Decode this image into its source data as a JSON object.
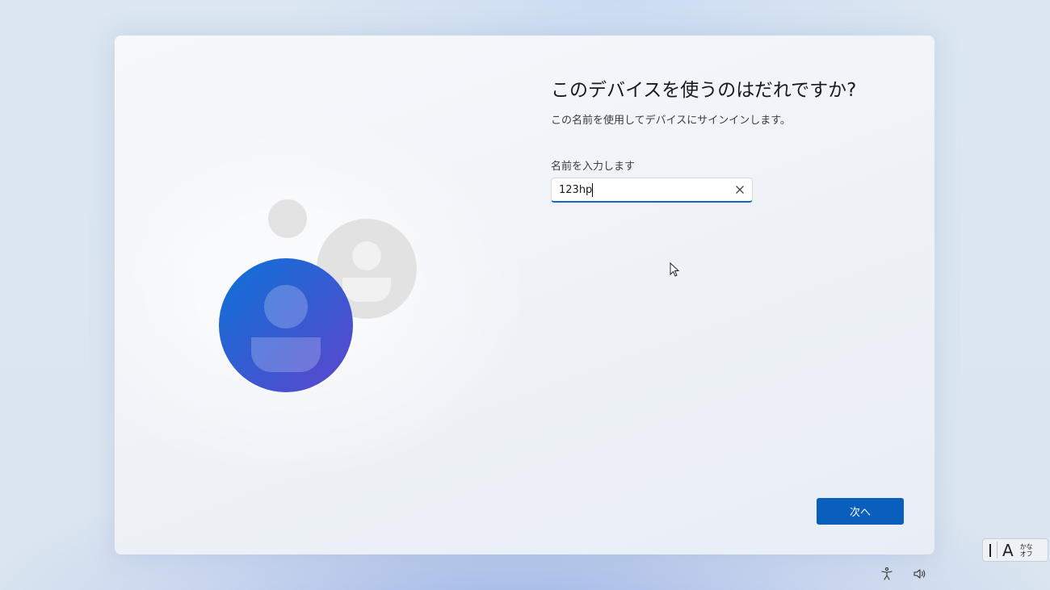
{
  "setup": {
    "title": "このデバイスを使うのはだれですか?",
    "subtitle": "この名前を使用してデバイスにサインインします。",
    "name_field": {
      "label": "名前を入力します",
      "value": "123hp"
    },
    "next_button_label": "次へ"
  },
  "ime_indicator": {
    "mode_letter": "A",
    "kana_line1": "かな",
    "kana_line2": "オフ"
  },
  "icons": {
    "clear": "close-icon",
    "accessibility": "accessibility-icon",
    "volume": "volume-icon",
    "avatar": "person-icon"
  },
  "colors": {
    "accent": "#0a5fbd",
    "avatar_gradient_start": "#1470d6",
    "avatar_gradient_end": "#5a49cf"
  }
}
